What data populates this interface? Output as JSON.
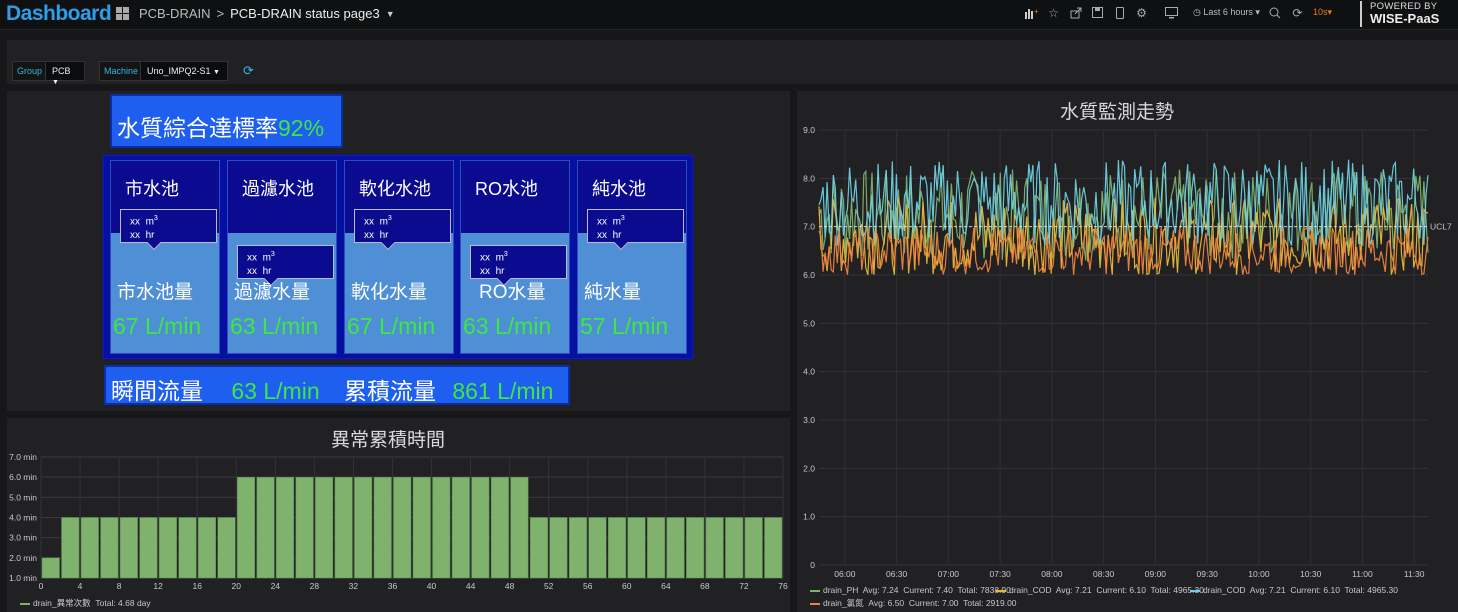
{
  "topbar": {
    "logo": "Dashboard",
    "breadcrumb_parent": "PCB-DRAIN",
    "breadcrumb_sep": ">",
    "breadcrumb_current": "PCB-DRAIN status page3",
    "time_range": "Last 6 hours",
    "refresh": "10s",
    "brand_top": "POWERED BY",
    "brand_bottom": "WISE-PaaS",
    "icons": [
      "add-panel-icon",
      "star-icon",
      "share-icon",
      "save-icon",
      "mobile-icon",
      "settings-icon",
      "monitor-icon",
      "clock-icon",
      "zoom-out-icon",
      "refresh-icon"
    ]
  },
  "variables": {
    "group_label": "Group",
    "group_value": "PCB",
    "machine_label": "Machine",
    "machine_value": "Uno_IMPQ2-S1"
  },
  "status_panel": {
    "rate_label": "水質綜合達標率",
    "rate_value": "92%",
    "pools": [
      {
        "name": "市水池",
        "volume_label": "市水池量",
        "flow": "67 L/min",
        "cap1": "xx",
        "unit1": "m",
        "cap2": "xx",
        "unit2": "hr",
        "water_level": 0.62
      },
      {
        "name": "過濾水池",
        "volume_label": "過濾水量",
        "flow": "63 L/min",
        "cap1": "xx",
        "unit1": "m",
        "cap2": "xx",
        "unit2": "hr",
        "water_level": 0.62
      },
      {
        "name": "軟化水池",
        "volume_label": "軟化水量",
        "flow": "67 L/min",
        "cap1": "xx",
        "unit1": "m",
        "cap2": "xx",
        "unit2": "hr",
        "water_level": 0.62
      },
      {
        "name": "RO水池",
        "volume_label": "RO水量",
        "flow": "63 L/min",
        "cap1": "xx",
        "unit1": "m",
        "cap2": "xx",
        "unit2": "hr",
        "water_level": 0.62
      },
      {
        "name": "純水池",
        "volume_label": "純水量",
        "flow": "57 L/min",
        "cap1": "xx",
        "unit1": "m",
        "cap2": "xx",
        "unit2": "hr",
        "water_level": 0.62
      }
    ],
    "instant_flow_label": "瞬間流量",
    "instant_flow_value": "63 L/min",
    "total_flow_label": "累積流量",
    "total_flow_value": "861 L/min"
  },
  "chart_data": [
    {
      "type": "bar",
      "title": "異常累積時間",
      "ylabel": "",
      "ylim": [
        1,
        7
      ],
      "yticks": [
        "1.0 min",
        "2.0 min",
        "3.0 min",
        "4.0 min",
        "5.0 min",
        "6.0 min",
        "7.0 min"
      ],
      "xticks": [
        "0",
        "4",
        "8",
        "12",
        "16",
        "20",
        "24",
        "28",
        "32",
        "36",
        "40",
        "44",
        "48",
        "52",
        "56",
        "60",
        "64",
        "68",
        "72",
        "76"
      ],
      "x": [
        0,
        2,
        4,
        6,
        8,
        10,
        12,
        14,
        16,
        18,
        20,
        22,
        24,
        26,
        28,
        30,
        32,
        34,
        36,
        38,
        40,
        42,
        44,
        46,
        48,
        50,
        52,
        54,
        56,
        58,
        60,
        62,
        64,
        66,
        68,
        70,
        72,
        74
      ],
      "values": [
        2,
        4,
        4,
        4,
        4,
        4,
        4,
        4,
        4,
        4,
        6,
        6,
        6,
        6,
        6,
        6,
        6,
        6,
        6,
        6,
        6,
        6,
        6,
        6,
        6,
        4,
        4,
        4,
        4,
        4,
        4,
        4,
        4,
        4,
        4,
        4,
        4,
        4
      ],
      "color": "#7eb26d",
      "grid": true,
      "legend": [
        {
          "name": "drain_異常次數",
          "text": "Total: 4.68 day",
          "color": "#7eb26d"
        }
      ]
    },
    {
      "type": "line",
      "title": "水質監測走勢",
      "ylim": [
        0,
        9
      ],
      "yticks": [
        "0",
        "1.0",
        "2.0",
        "3.0",
        "4.0",
        "5.0",
        "6.0",
        "7.0",
        "8.0",
        "9.0"
      ],
      "xticks": [
        "06:00",
        "06:30",
        "07:00",
        "07:30",
        "08:00",
        "08:30",
        "09:00",
        "09:30",
        "10:00",
        "10:30",
        "11:00",
        "11:30"
      ],
      "threshold": {
        "label": "UCL7",
        "value": 7.0
      },
      "grid": true,
      "series": [
        {
          "name": "drain_PH",
          "color": "#7eb26d",
          "range": [
            6.3,
            8.2
          ],
          "avg": "7.24",
          "current": "7.40",
          "total": "7838.90"
        },
        {
          "name": "drain_COD",
          "color": "#eab839",
          "range": [
            6.0,
            7.6
          ],
          "avg": "7.21",
          "current": "6.10",
          "total": "4965.30"
        },
        {
          "name": "drain_COD",
          "color": "#6ed0e0",
          "range": [
            6.6,
            8.4
          ],
          "avg": "7.21",
          "current": "6.10",
          "total": "4965.30"
        },
        {
          "name": "drain_氯氮",
          "color": "#ef843c",
          "range": [
            6.0,
            7.0
          ],
          "avg": "6.50",
          "current": "7.00",
          "total": "2919.00"
        }
      ]
    }
  ],
  "legend_text": {
    "avg": "Avg:",
    "current": "Current:",
    "total": "Total:"
  }
}
